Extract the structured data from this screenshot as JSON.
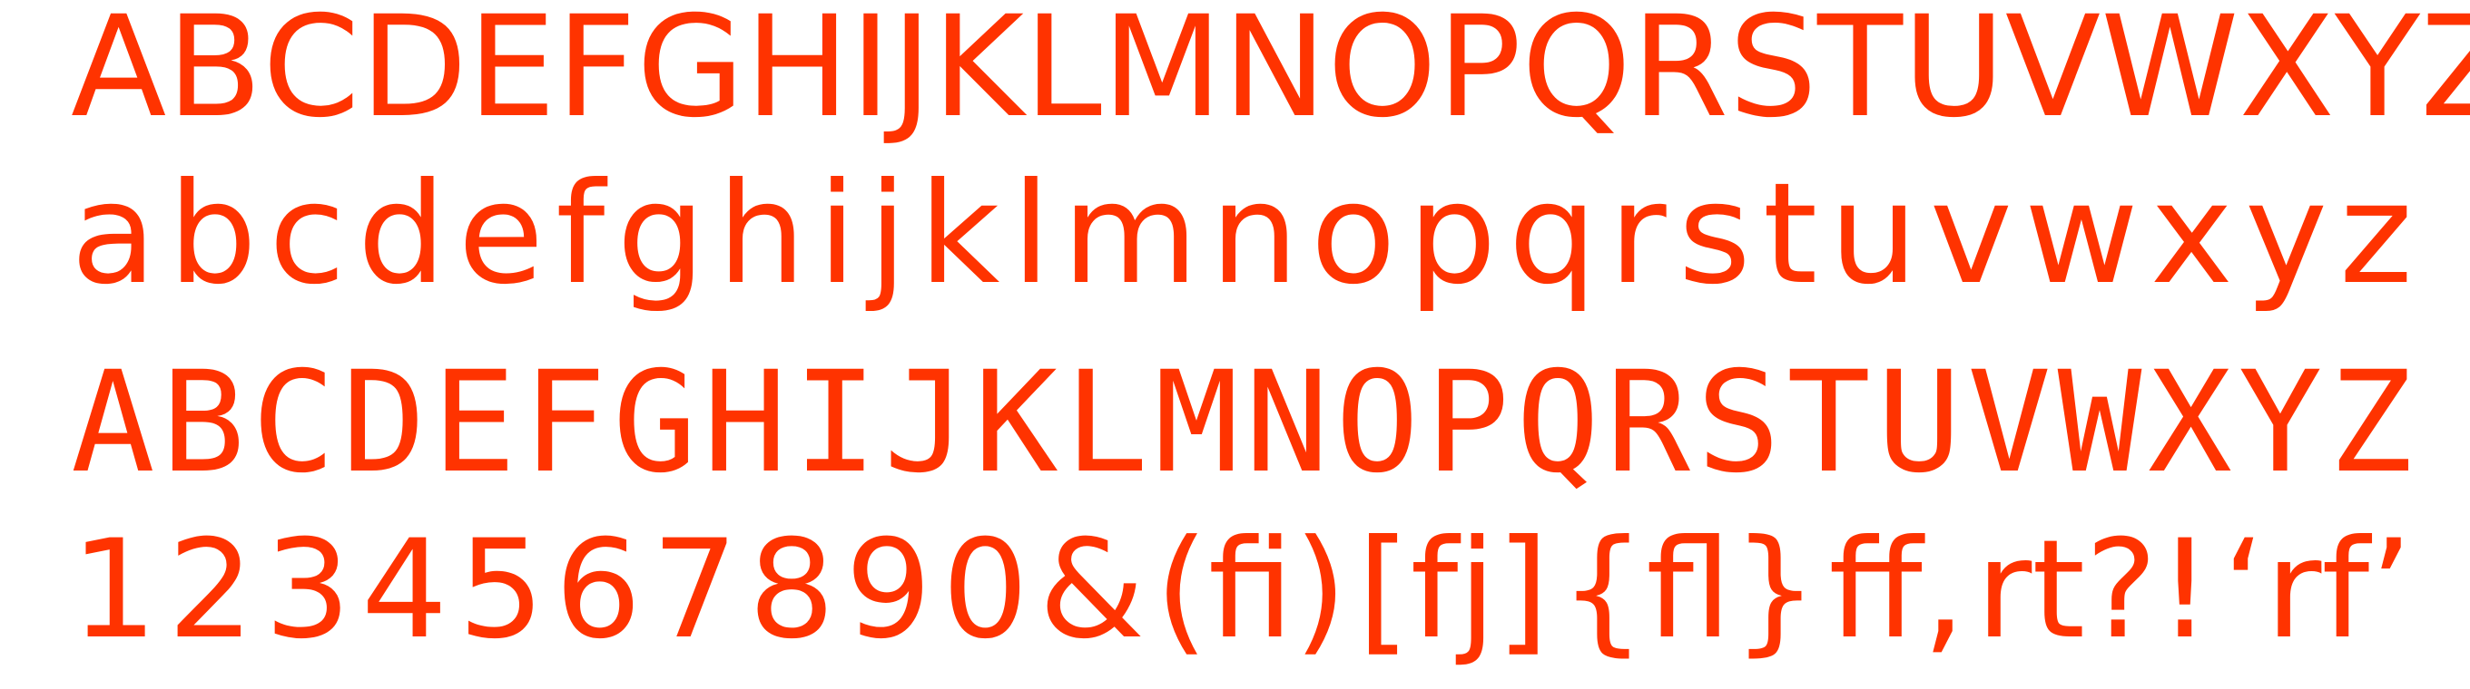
{
  "specimen": {
    "color": "#ff3300",
    "rows": [
      {
        "name": "uppercase-row-1",
        "glyphs": [
          "A",
          "B",
          "C",
          "D",
          "E",
          "F",
          "G",
          "H",
          "I",
          "J",
          "K",
          "L",
          "M",
          "N",
          "O",
          "P",
          "Q",
          "R",
          "S",
          "T",
          "U",
          "V",
          "W",
          "X",
          "Y",
          "Z"
        ]
      },
      {
        "name": "lowercase-row",
        "glyphs": [
          "a",
          "b",
          "c",
          "d",
          "e",
          "f",
          "g",
          "h",
          "i",
          "j",
          "k",
          "l",
          "m",
          "n",
          "o",
          "p",
          "q",
          "r",
          "s",
          "t",
          "u",
          "v",
          "w",
          "x",
          "y",
          "z"
        ]
      },
      {
        "name": "uppercase-row-2",
        "glyphs": [
          "A",
          "B",
          "C",
          "D",
          "E",
          "F",
          "G",
          "H",
          "I",
          "J",
          "K",
          "L",
          "M",
          "N",
          "O",
          "P",
          "Q",
          "R",
          "S",
          "T",
          "U",
          "V",
          "W",
          "X",
          "Y",
          "Z"
        ]
      },
      {
        "name": "figures-row",
        "glyphs": [
          "1",
          "2",
          "3",
          "4",
          "5",
          "6",
          "7",
          "8",
          "9",
          "0",
          "&",
          "(fi)",
          "[fj]",
          "{fl}",
          "ff,",
          "rt?!",
          "‘rf’"
        ]
      }
    ]
  }
}
